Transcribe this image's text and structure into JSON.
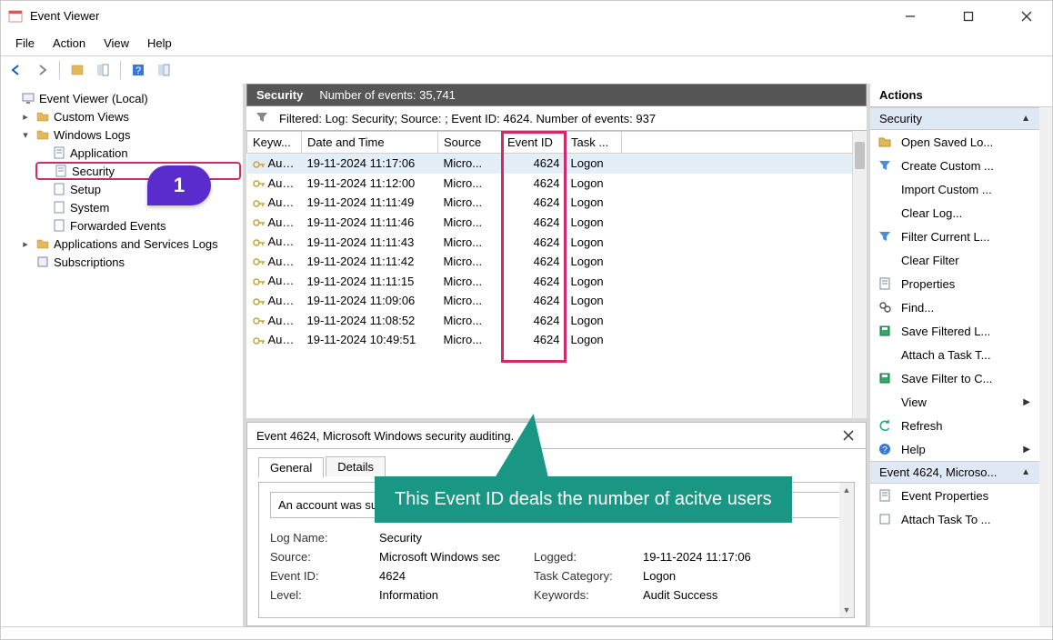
{
  "window": {
    "title": "Event Viewer"
  },
  "menu": {
    "file": "File",
    "action": "Action",
    "view": "View",
    "help": "Help"
  },
  "tree": {
    "root": "Event Viewer (Local)",
    "custom": "Custom Views",
    "winlogs": "Windows Logs",
    "application": "Application",
    "security": "Security",
    "setup": "Setup",
    "system": "System",
    "forwarded": "Forwarded Events",
    "appsvc": "Applications and Services Logs",
    "subs": "Subscriptions"
  },
  "center": {
    "header_label": "Security",
    "header_count": "Number of events: 35,741",
    "filter_text": "Filtered: Log: Security; Source: ; Event ID: 4624. Number of events: 937",
    "cols": {
      "key": "Keyw...",
      "date": "Date and Time",
      "src": "Source",
      "eid": "Event ID",
      "task": "Task ..."
    },
    "rows": [
      {
        "key": "Aud...",
        "date": "19-11-2024 11:17:06",
        "src": "Micro...",
        "eid": "4624",
        "task": "Logon"
      },
      {
        "key": "Aud...",
        "date": "19-11-2024 11:12:00",
        "src": "Micro...",
        "eid": "4624",
        "task": "Logon"
      },
      {
        "key": "Aud...",
        "date": "19-11-2024 11:11:49",
        "src": "Micro...",
        "eid": "4624",
        "task": "Logon"
      },
      {
        "key": "Aud...",
        "date": "19-11-2024 11:11:46",
        "src": "Micro...",
        "eid": "4624",
        "task": "Logon"
      },
      {
        "key": "Aud...",
        "date": "19-11-2024 11:11:43",
        "src": "Micro...",
        "eid": "4624",
        "task": "Logon"
      },
      {
        "key": "Aud...",
        "date": "19-11-2024 11:11:42",
        "src": "Micro...",
        "eid": "4624",
        "task": "Logon"
      },
      {
        "key": "Aud...",
        "date": "19-11-2024 11:11:15",
        "src": "Micro...",
        "eid": "4624",
        "task": "Logon"
      },
      {
        "key": "Aud...",
        "date": "19-11-2024 11:09:06",
        "src": "Micro...",
        "eid": "4624",
        "task": "Logon"
      },
      {
        "key": "Aud...",
        "date": "19-11-2024 11:08:52",
        "src": "Micro...",
        "eid": "4624",
        "task": "Logon"
      },
      {
        "key": "Aud...",
        "date": "19-11-2024 10:49:51",
        "src": "Micro...",
        "eid": "4624",
        "task": "Logon"
      }
    ]
  },
  "detail": {
    "header": "Event 4624, Microsoft Windows security auditing.",
    "tab_general": "General",
    "tab_details": "Details",
    "description": "An account was successfully logged on",
    "labels": {
      "logname": "Log Name:",
      "source": "Source:",
      "eventid": "Event ID:",
      "level": "Level:",
      "logged": "Logged:",
      "taskcat": "Task Category:",
      "keywords": "Keywords:"
    },
    "vals": {
      "logname": "Security",
      "source": "Microsoft Windows sec",
      "eventid": "4624",
      "level": "Information",
      "logged": "19-11-2024 11:17:06",
      "taskcat": "Logon",
      "keywords": "Audit Success"
    }
  },
  "actions": {
    "title": "Actions",
    "group1": "Security",
    "items1": [
      "Open Saved Lo...",
      "Create Custom ...",
      "Import Custom ...",
      "Clear Log...",
      "Filter Current L...",
      "Clear Filter",
      "Properties",
      "Find...",
      "Save Filtered L...",
      "Attach a Task T...",
      "Save Filter to C...",
      "View",
      "Refresh",
      "Help"
    ],
    "group2": "Event 4624, Microso...",
    "items2": [
      "Event Properties",
      "Attach Task To ..."
    ]
  },
  "annotations": {
    "badge": "1",
    "callout": "This Event ID deals the number of acitve users"
  }
}
